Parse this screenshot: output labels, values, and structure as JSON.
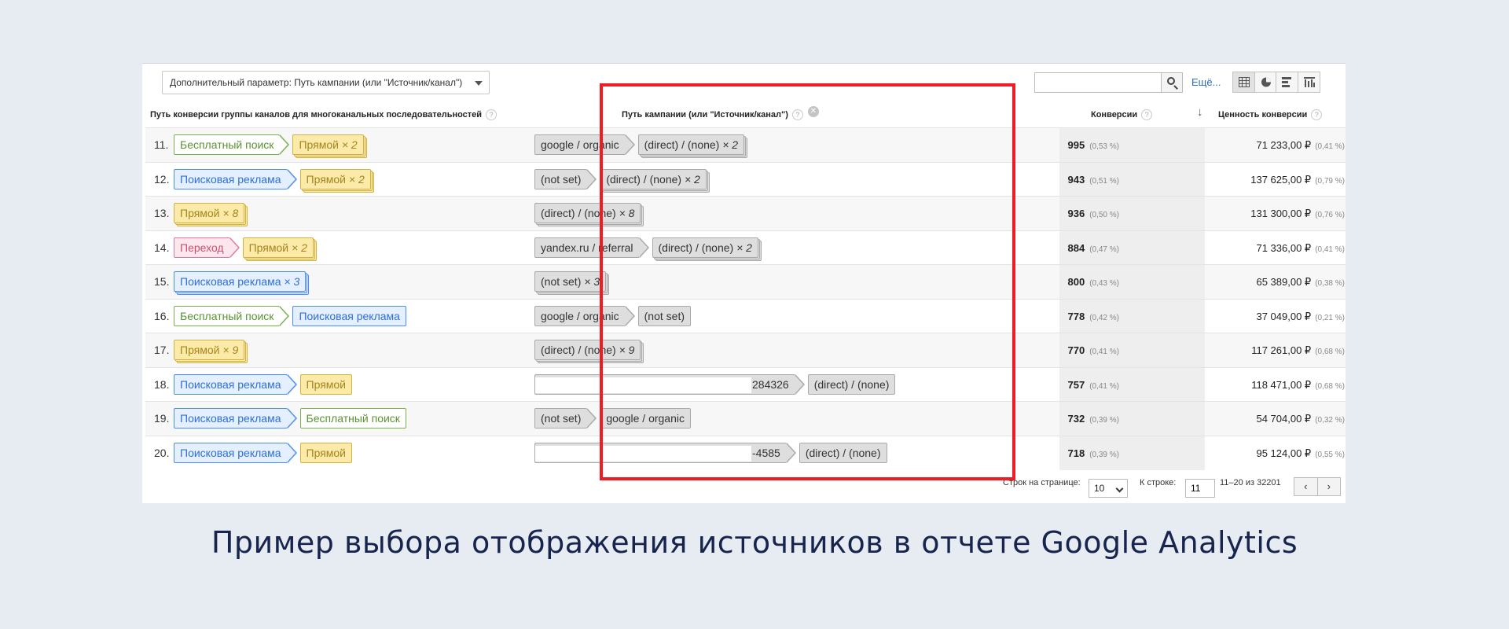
{
  "toolbar": {
    "secondary_dimension": "Дополнительный параметр: Путь кампании (или \"Источник/канал\")",
    "search_value": "",
    "more_label": "Ещё..."
  },
  "headers": {
    "path": "Путь конверсии группы каналов для многоканальных последовательностей",
    "campaign": "Путь кампании (или \"Источник/канал\")",
    "conversions": "Конверсии",
    "value": "Ценность конверсии",
    "help": "?",
    "clear": "✕",
    "sort": "↓"
  },
  "rows": [
    {
      "num": "11.",
      "path": [
        {
          "label": "Бесплатный поиск",
          "mult": "",
          "color": "green"
        },
        {
          "label": "Прямой",
          "mult": "× 2",
          "color": "yellow"
        }
      ],
      "campaign": [
        {
          "label": "google / organic",
          "mult": ""
        },
        {
          "label": "(direct) / (none)",
          "mult": "× 2"
        }
      ],
      "conversions": "995",
      "conv_pct": "(0,53 %)",
      "value": "71 233,00 ₽",
      "value_pct": "(0,41 %)"
    },
    {
      "num": "12.",
      "path": [
        {
          "label": "Поисковая реклама",
          "mult": "",
          "color": "blue"
        },
        {
          "label": "Прямой",
          "mult": "× 2",
          "color": "yellow"
        }
      ],
      "campaign": [
        {
          "label": "(not set)",
          "mult": ""
        },
        {
          "label": "(direct) / (none)",
          "mult": "× 2"
        }
      ],
      "conversions": "943",
      "conv_pct": "(0,51 %)",
      "value": "137 625,00 ₽",
      "value_pct": "(0,79 %)"
    },
    {
      "num": "13.",
      "path": [
        {
          "label": "Прямой",
          "mult": "× 8",
          "color": "yellow"
        }
      ],
      "campaign": [
        {
          "label": "(direct) / (none)",
          "mult": "× 8"
        }
      ],
      "conversions": "936",
      "conv_pct": "(0,50 %)",
      "value": "131 300,00 ₽",
      "value_pct": "(0,76 %)"
    },
    {
      "num": "14.",
      "path": [
        {
          "label": "Переход",
          "mult": "",
          "color": "pink"
        },
        {
          "label": "Прямой",
          "mult": "× 2",
          "color": "yellow"
        }
      ],
      "campaign": [
        {
          "label": "yandex.ru / referral",
          "mult": ""
        },
        {
          "label": "(direct) / (none)",
          "mult": "× 2"
        }
      ],
      "conversions": "884",
      "conv_pct": "(0,47 %)",
      "value": "71 336,00 ₽",
      "value_pct": "(0,41 %)"
    },
    {
      "num": "15.",
      "path": [
        {
          "label": "Поисковая реклама",
          "mult": "× 3",
          "color": "blue"
        }
      ],
      "campaign": [
        {
          "label": "(not set)",
          "mult": "× 3"
        }
      ],
      "conversions": "800",
      "conv_pct": "(0,43 %)",
      "value": "65 389,00 ₽",
      "value_pct": "(0,38 %)"
    },
    {
      "num": "16.",
      "path": [
        {
          "label": "Бесплатный поиск",
          "mult": "",
          "color": "green"
        },
        {
          "label": "Поисковая реклама",
          "mult": "",
          "color": "blue"
        }
      ],
      "campaign": [
        {
          "label": "google / organic",
          "mult": ""
        },
        {
          "label": "(not set)",
          "mult": ""
        }
      ],
      "conversions": "778",
      "conv_pct": "(0,42 %)",
      "value": "37 049,00 ₽",
      "value_pct": "(0,21 %)"
    },
    {
      "num": "17.",
      "path": [
        {
          "label": "Прямой",
          "mult": "× 9",
          "color": "yellow"
        }
      ],
      "campaign": [
        {
          "label": "(direct) / (none)",
          "mult": "× 9"
        }
      ],
      "conversions": "770",
      "conv_pct": "(0,41 %)",
      "value": "117 261,00 ₽",
      "value_pct": "(0,68 %)"
    },
    {
      "num": "18.",
      "path": [
        {
          "label": "Поисковая реклама",
          "mult": "",
          "color": "blue"
        },
        {
          "label": "Прямой",
          "mult": "",
          "color": "yellow"
        }
      ],
      "campaign": [
        {
          "label": "284326",
          "mult": "",
          "redacted": true
        },
        {
          "label": "(direct) / (none)",
          "mult": ""
        }
      ],
      "conversions": "757",
      "conv_pct": "(0,41 %)",
      "value": "118 471,00 ₽",
      "value_pct": "(0,68 %)"
    },
    {
      "num": "19.",
      "path": [
        {
          "label": "Поисковая реклама",
          "mult": "",
          "color": "blue"
        },
        {
          "label": "Бесплатный поиск",
          "mult": "",
          "color": "green"
        }
      ],
      "campaign": [
        {
          "label": "(not set)",
          "mult": ""
        },
        {
          "label": "google / organic",
          "mult": ""
        }
      ],
      "conversions": "732",
      "conv_pct": "(0,39 %)",
      "value": "54 704,00 ₽",
      "value_pct": "(0,32 %)"
    },
    {
      "num": "20.",
      "path": [
        {
          "label": "Поисковая реклама",
          "mult": "",
          "color": "blue"
        },
        {
          "label": "Прямой",
          "mult": "",
          "color": "yellow"
        }
      ],
      "campaign": [
        {
          "label": "-4585",
          "mult": "",
          "redacted": true
        },
        {
          "label": "(direct) / (none)",
          "mult": ""
        }
      ],
      "conversions": "718",
      "conv_pct": "(0,39 %)",
      "value": "95 124,00 ₽",
      "value_pct": "(0,55 %)"
    }
  ],
  "footer": {
    "rows_per_page_label": "Строк на странице:",
    "rows_per_page_value": "10",
    "goto_label": "К строке:",
    "goto_value": "11",
    "range_text": "11–20 из 32201",
    "prev": "‹",
    "next": "›"
  },
  "caption": "Пример выбора отображения источников в отчете Google Analytics",
  "colors": {
    "highlight": "#ef1c24",
    "green": "#79b04a",
    "blue": "#4c8ef0",
    "yellow": "#d1b044",
    "pink": "#e07a98",
    "gray": "#a9a9a9"
  }
}
